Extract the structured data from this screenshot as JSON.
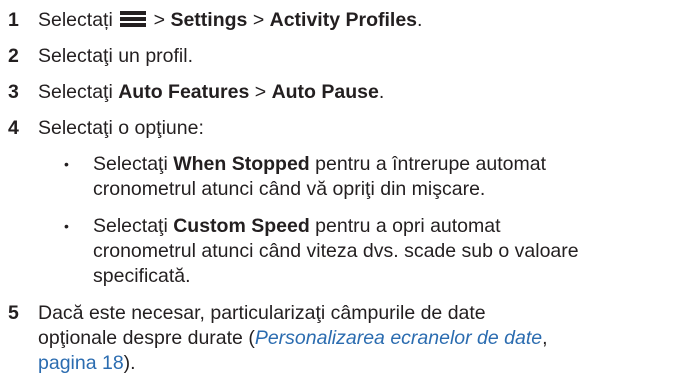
{
  "steps": [
    {
      "number": "1",
      "verb": "Selectați",
      "sep1": ">",
      "item1": "Settings",
      "sep2": ">",
      "item2": "Activity Profiles",
      "end": "."
    },
    {
      "number": "2",
      "text": "Selectaţi un profil."
    },
    {
      "number": "3",
      "verb": "Selectaţi",
      "item1": "Auto Features",
      "sep": ">",
      "item2": "Auto Pause",
      "end": "."
    },
    {
      "number": "4",
      "text": "Selectaţi o opţiune:",
      "bullets": [
        {
          "marker": "•",
          "verb": "Selectaţi",
          "option": "When Stopped",
          "line1_rest": "pentru a întrerupe automat",
          "line2": "cronometrul atunci când vă opriţi din mişcare."
        },
        {
          "marker": "•",
          "verb": "Selectaţi",
          "option": "Custom Speed",
          "line1_rest": "pentru a opri automat",
          "line2": "cronometrul atunci când viteza dvs. scade sub o valoare",
          "line3": "specificată."
        }
      ]
    },
    {
      "number": "5",
      "line1": "Dacă este necesar, particularizaţi câmpurile de date",
      "line2_start": "opţionale despre durate (",
      "link_text": "Personalizarea ecranelor de date",
      "line2_comma": ",",
      "page_link": "pagina 18",
      "line3_end": ")."
    }
  ],
  "icons": {
    "menu": "menu-icon"
  }
}
